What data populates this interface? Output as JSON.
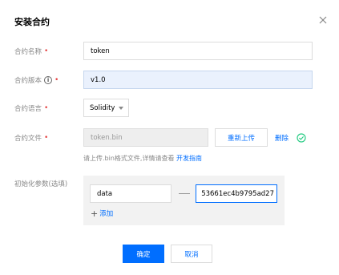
{
  "dialog": {
    "title": "安装合约"
  },
  "form": {
    "name": {
      "label": "合约名称",
      "value": "token"
    },
    "version": {
      "label": "合约版本",
      "info": "i",
      "value": "v1.0"
    },
    "language": {
      "label": "合约语言",
      "selected": "Solidity"
    },
    "file": {
      "label": "合约文件",
      "value": "token.bin",
      "reupload_label": "重新上传",
      "delete_label": "删除",
      "hint_text": "请上传.bin格式文件,详情请查看 ",
      "hint_link": "开发指南"
    },
    "params": {
      "label": "初始化参数(选填)",
      "key": "data",
      "value": "53661ec4b9795ad27",
      "add_plus": "+",
      "add_label": "添加"
    },
    "required_mark": "•"
  },
  "footer": {
    "confirm_label": "确定",
    "cancel_label": "取消"
  },
  "colors": {
    "primary": "#006eff",
    "success": "#29cc85",
    "required": "#e54545"
  }
}
